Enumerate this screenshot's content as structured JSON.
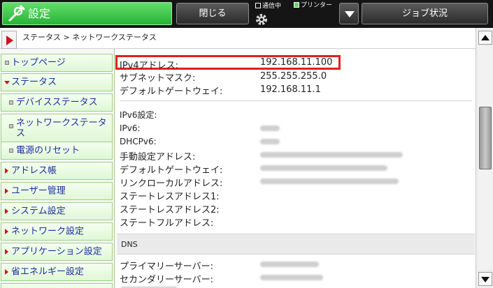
{
  "header": {
    "app_title": "設定",
    "close_label": "閉じる",
    "status_comm": "通信中",
    "status_printer": "プリンター",
    "job_status_label": "ジョブ状況",
    "accent": "#2fbb3f"
  },
  "breadcrumb": "ステータス > ネットワークステータス",
  "sidebar": {
    "items": [
      {
        "label": "トップページ"
      },
      {
        "label": "ステータス"
      },
      {
        "label": "デバイスステータス"
      },
      {
        "label": "ネットワークステータス"
      },
      {
        "label": "電源のリセット"
      },
      {
        "label": "アドレス帳"
      },
      {
        "label": "ユーザー管理"
      },
      {
        "label": "システム設定"
      },
      {
        "label": "ネットワーク設定"
      },
      {
        "label": "アプリケーション設定"
      },
      {
        "label": "省エネルギー設定"
      }
    ]
  },
  "ipv4": {
    "address_label": "IPv4アドレス:",
    "address_value": "192.168.11.100",
    "subnet_label": "サブネットマスク:",
    "subnet_value": "255.255.255.0",
    "gateway_label": "デフォルトゲートウェイ:",
    "gateway_value": "192.168.11.1"
  },
  "ipv6": {
    "settings_label": "IPv6設定:",
    "ipv6_label": "IPv6:",
    "dhcpv6_label": "DHCPv6:",
    "manual_addr_label": "手動設定アドレス:",
    "gateway_label": "デフォルトゲートウェイ:",
    "link_local_label": "リンクローカルアドレス:",
    "stateless1_label": "ステートレスアドレス1:",
    "stateless2_label": "ステートレスアドレス2:",
    "stateful_label": "ステートフルアドレス:"
  },
  "dns": {
    "section_label": "DNS",
    "primary_label": "プライマリーサーバー:",
    "secondary_label": "セカンダリーサーバー:"
  }
}
